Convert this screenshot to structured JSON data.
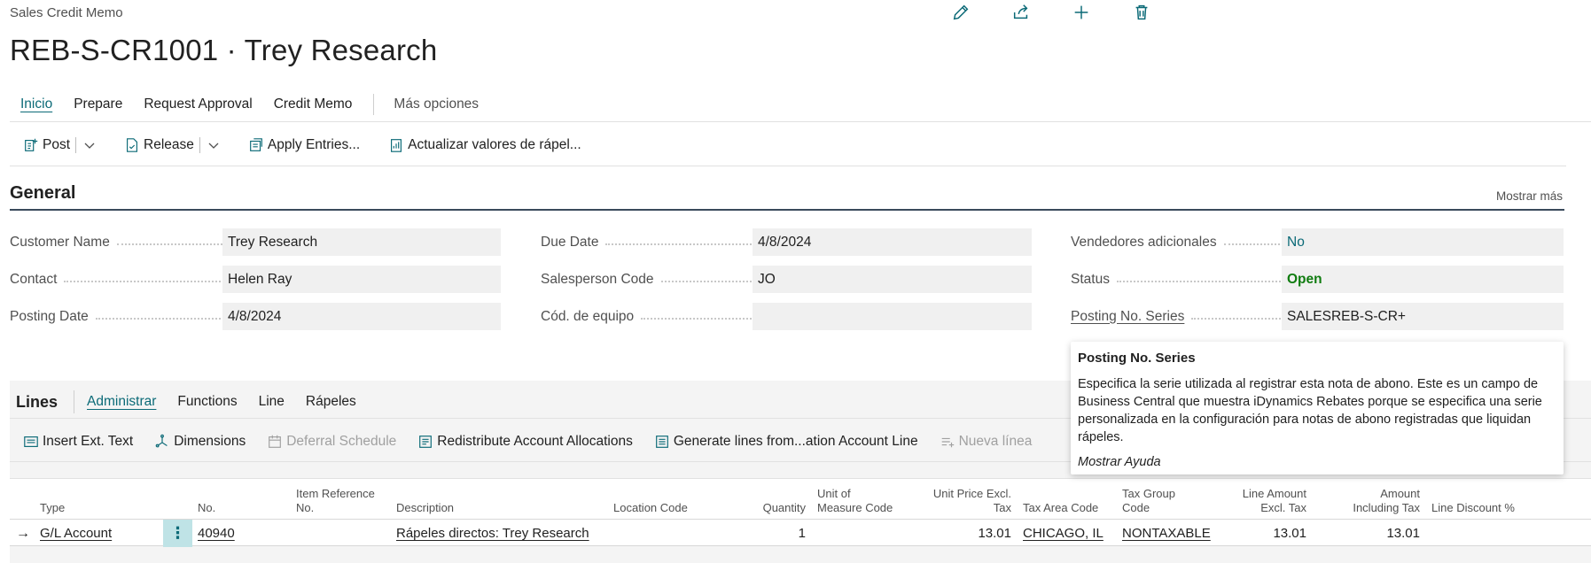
{
  "page": {
    "type": "Sales Credit Memo",
    "title": "REB-S-CR1001 · Trey Research"
  },
  "header_actions": [
    {
      "icon": "pencil-icon"
    },
    {
      "icon": "share-icon"
    },
    {
      "icon": "plus-icon"
    },
    {
      "icon": "trash-icon"
    }
  ],
  "nav": {
    "tabs": [
      "Inicio",
      "Prepare",
      "Request Approval",
      "Credit Memo"
    ],
    "more": "Más opciones",
    "active": "Inicio"
  },
  "actions": {
    "post": "Post",
    "release": "Release",
    "apply_entries": "Apply Entries...",
    "update_rebates": "Actualizar valores de rápel..."
  },
  "general": {
    "title": "General",
    "show_more": "Mostrar más",
    "fields": {
      "customer_name": {
        "label": "Customer Name",
        "value": "Trey Research"
      },
      "contact": {
        "label": "Contact",
        "value": "Helen Ray"
      },
      "posting_date": {
        "label": "Posting Date",
        "value": "4/8/2024"
      },
      "due_date": {
        "label": "Due Date",
        "value": "4/8/2024"
      },
      "salesperson_code": {
        "label": "Salesperson Code",
        "value": "JO"
      },
      "team_code": {
        "label": "Cód. de equipo",
        "value": ""
      },
      "additional_salespeople": {
        "label": "Vendedores adicionales",
        "value": "No"
      },
      "status": {
        "label": "Status",
        "value": "Open"
      },
      "posting_no_series": {
        "label": "Posting No. Series",
        "value": "SALESREB-S-CR+"
      }
    }
  },
  "tooltip": {
    "title": "Posting No. Series",
    "body": "Especifica la serie utilizada al registrar esta nota de abono. Este es un campo de Business Central que muestra iDynamics Rebates porque se especifica una serie personalizada en la configuración para notas de abono registradas que liquidan rápeles.",
    "help": "Mostrar Ayuda"
  },
  "lines": {
    "title": "Lines",
    "tabs": [
      "Administrar",
      "Functions",
      "Line",
      "Rápeles"
    ],
    "active_tab": "Administrar",
    "actions": {
      "insert_ext_text": "Insert Ext. Text",
      "dimensions": "Dimensions",
      "deferral_schedule": "Deferral Schedule",
      "redistribute": "Redistribute Account Allocations",
      "generate_lines": "Generate lines from...ation Account Line",
      "new_line": "Nueva línea"
    },
    "columns": {
      "type": "Type",
      "no": "No.",
      "item_ref_1": "Item Reference",
      "item_ref_2": "No.",
      "description": "Description",
      "location_code": "Location Code",
      "quantity": "Quantity",
      "uom_1": "Unit of",
      "uom_2": "Measure Code",
      "unit_price_1": "Unit Price Excl.",
      "unit_price_2": "Tax",
      "tax_area_code": "Tax Area Code",
      "tax_group_1": "Tax Group",
      "tax_group_2": "Code",
      "line_amount_1": "Line Amount",
      "line_amount_2": "Excl. Tax",
      "amount_incl_1": "Amount",
      "amount_incl_2": "Including Tax",
      "line_discount": "Line Discount %"
    },
    "row": {
      "type": "G/L Account",
      "no": "40940",
      "description": "Rápeles directos: Trey Research",
      "quantity": "1",
      "unit_price": "13.01",
      "tax_area_code": "CHICAGO, IL",
      "tax_group_code": "NONTAXABLE",
      "line_amount": "13.01",
      "amount_incl_tax": "13.01"
    }
  }
}
